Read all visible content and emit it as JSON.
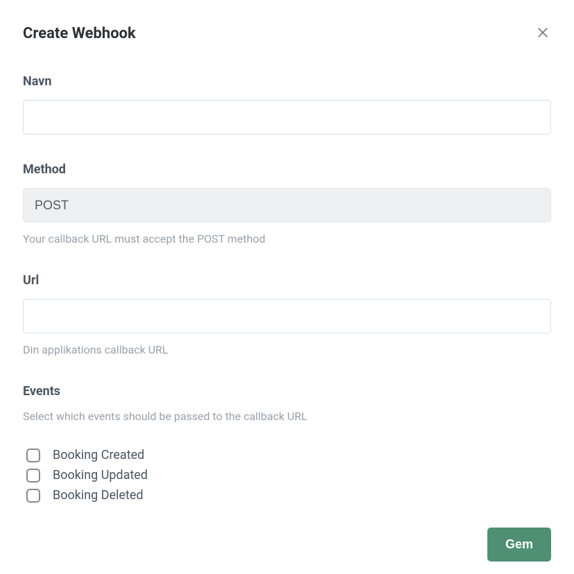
{
  "modal": {
    "title": "Create Webhook",
    "fields": {
      "name": {
        "label": "Navn",
        "value": ""
      },
      "method": {
        "label": "Method",
        "value": "POST",
        "help": "Your callback URL must accept the POST method"
      },
      "url": {
        "label": "Url",
        "value": "",
        "help": "Din applikations callback URL"
      },
      "events": {
        "label": "Events",
        "help": "Select which events should be passed to the callback URL",
        "items": [
          {
            "label": "Booking Created"
          },
          {
            "label": "Booking Updated"
          },
          {
            "label": "Booking Deleted"
          }
        ]
      }
    },
    "buttons": {
      "save": "Gem"
    }
  }
}
